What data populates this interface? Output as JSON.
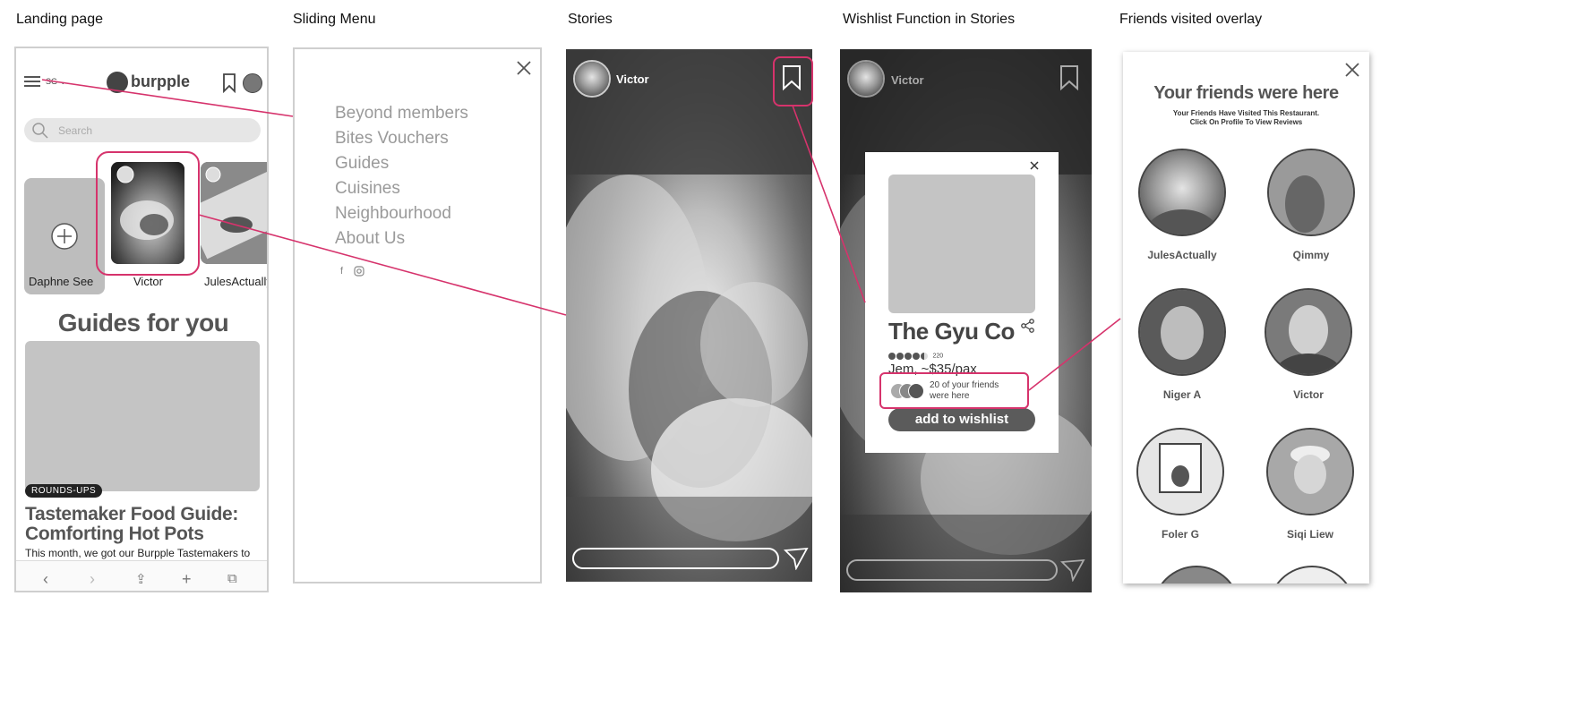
{
  "sections": {
    "landing": "Landing page",
    "sliding_menu": "Sliding Menu",
    "stories": "Stories",
    "wishlist": "Wishlist Function in Stories",
    "friends_overlay": "Friends visited overlay"
  },
  "landing": {
    "region": "SG",
    "logo_text": "burpple",
    "search_placeholder": "Search",
    "stories": [
      {
        "label": "Daphne See"
      },
      {
        "label": "Victor"
      },
      {
        "label": "JulesActually"
      }
    ],
    "guides_heading": "Guides for you",
    "badge": "ROUNDS-UPS",
    "article_title": "Tastemaker Food Guide: Comforting Hot Pots",
    "article_sub": "This month, we got our Burpple Tastemakers to"
  },
  "menu": {
    "items": [
      "Beyond members",
      "Bites Vouchers",
      "Guides",
      "Cuisines",
      "Neighbourhood",
      "About Us"
    ]
  },
  "story": {
    "user": "Victor"
  },
  "wishlist": {
    "user": "Victor",
    "restaurant": "The Gyu Co",
    "rating_count": "220",
    "price": "Jem, ~$35/pax",
    "friends_text": "20 of your friends were here",
    "button": "add to wishlist"
  },
  "friends_overlay": {
    "title": "Your friends were here",
    "subtitle": "Your Friends Have Visited This Restaurant. Click On Profile To View Reviews",
    "friends": [
      {
        "name": "JulesActually"
      },
      {
        "name": "Qimmy"
      },
      {
        "name": "Niger A"
      },
      {
        "name": "Victor"
      },
      {
        "name": "Foler G"
      },
      {
        "name": "Siqi Liew"
      }
    ]
  },
  "colors": {
    "accent": "#d6336c",
    "background": "#ffffff"
  }
}
